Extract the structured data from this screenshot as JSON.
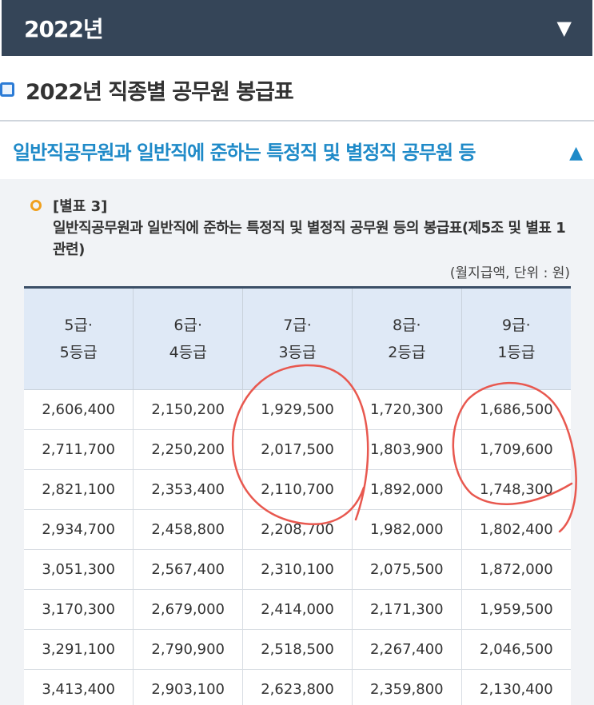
{
  "header": {
    "year": "2022년",
    "toggle_icon": "triangle-down-icon"
  },
  "section": {
    "title": "2022년 직종별 공무원 봉급표",
    "icon": "square-bullet-icon"
  },
  "accordion": {
    "title": "일반직공무원과 일반직에 준하는 특정직 및 별정직 공무원 등",
    "toggle_icon": "triangle-up-icon"
  },
  "note": {
    "label": "[별표 3]",
    "description": "일반직공무원과 일반직에 준하는 특정직 및 별정직 공무원 등의 봉급표(제5조 및 별표 1 관련)",
    "unit": "(월지급액, 단위 : 원)"
  },
  "table": {
    "headers": [
      "5급·\n5등급",
      "6급·\n4등급",
      "7급·\n3등급",
      "8급·\n2등급",
      "9급·\n1등급"
    ],
    "rows": [
      [
        "2,606,400",
        "2,150,200",
        "1,929,500",
        "1,720,300",
        "1,686,500"
      ],
      [
        "2,711,700",
        "2,250,200",
        "2,017,500",
        "1,803,900",
        "1,709,600"
      ],
      [
        "2,821,100",
        "2,353,400",
        "2,110,700",
        "1,892,000",
        "1,748,300"
      ],
      [
        "2,934,700",
        "2,458,800",
        "2,208,700",
        "1,982,000",
        "1,802,400"
      ],
      [
        "3,051,300",
        "2,567,400",
        "2,310,100",
        "2,075,500",
        "1,872,000"
      ],
      [
        "3,170,300",
        "2,679,000",
        "2,414,000",
        "2,171,300",
        "1,959,500"
      ],
      [
        "3,291,100",
        "2,790,900",
        "2,518,500",
        "2,267,400",
        "2,046,500"
      ],
      [
        "3,413,400",
        "2,903,100",
        "2,623,800",
        "2,359,800",
        "2,130,400"
      ]
    ]
  },
  "colors": {
    "header_bg": "#354558",
    "accent_blue": "#1f8ac8",
    "bullet_orange": "#f0a01e",
    "table_header_bg": "#dfe9f6",
    "annotation_red": "#e8584f"
  }
}
